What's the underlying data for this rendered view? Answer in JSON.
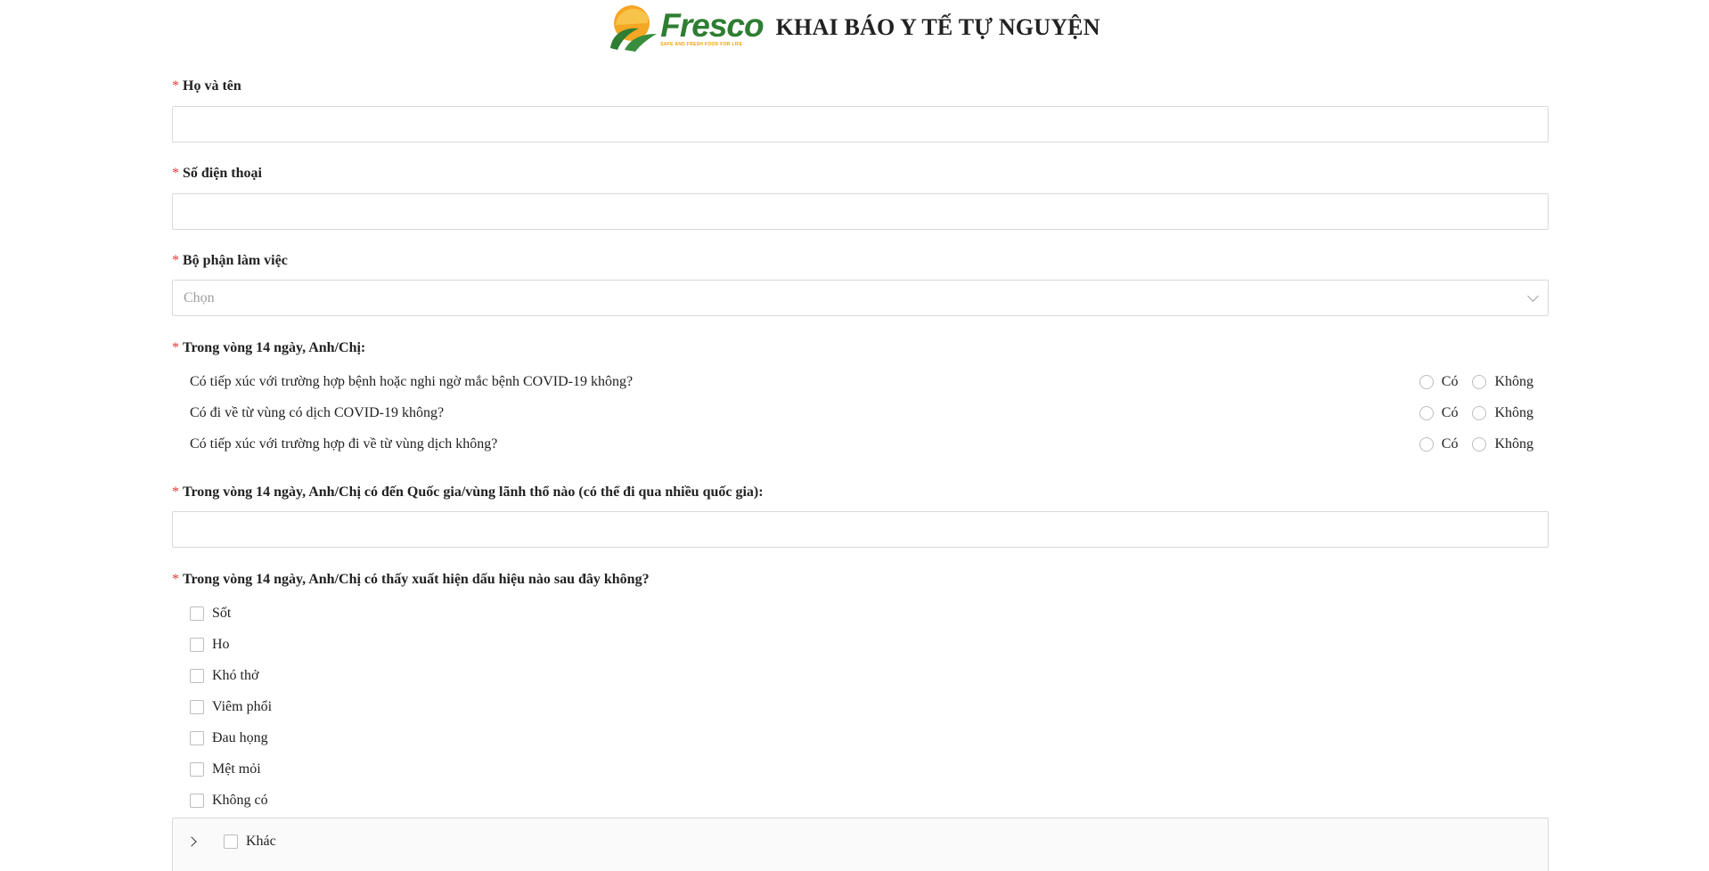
{
  "header": {
    "brand_name": "Fresco",
    "brand_tagline": "SAFE AND FRESH FOOD FOR LIFE",
    "title": "KHAI BÁO Y TẾ TỰ NGUYỆN",
    "colors": {
      "brand_green": "#2e7d32",
      "brand_orange": "#f0a000"
    }
  },
  "form": {
    "required_mark": "*",
    "full_name": {
      "label": "Họ và tên",
      "value": "",
      "placeholder": ""
    },
    "phone": {
      "label": "Số điện thoại",
      "value": "",
      "placeholder": ""
    },
    "department": {
      "label": "Bộ phận làm việc",
      "placeholder": "Chọn",
      "selected": ""
    },
    "exposure": {
      "label": "Trong vòng 14 ngày, Anh/Chị:",
      "option_yes": "Có",
      "option_no": "Không",
      "questions": [
        {
          "text": "Có tiếp xúc với trường hợp bệnh hoặc nghi ngờ mắc bệnh COVID-19 không?",
          "answer": null
        },
        {
          "text": "Có đi về từ vùng có dịch COVID-19 không?",
          "answer": null
        },
        {
          "text": "Có tiếp xúc với trường hợp đi về từ vùng dịch không?",
          "answer": null
        }
      ]
    },
    "countries": {
      "label": "Trong vòng 14 ngày, Anh/Chị có đến Quốc gia/vùng lãnh thổ nào (có thể đi qua nhiều quốc gia):",
      "value": ""
    },
    "symptoms": {
      "label": "Trong vòng 14 ngày, Anh/Chị có thấy xuất hiện dấu hiệu nào sau đây không?",
      "items": [
        {
          "label": "Sốt",
          "checked": false
        },
        {
          "label": "Ho",
          "checked": false
        },
        {
          "label": "Khó thở",
          "checked": false
        },
        {
          "label": "Viêm phổi",
          "checked": false
        },
        {
          "label": "Đau họng",
          "checked": false
        },
        {
          "label": "Mệt mỏi",
          "checked": false
        },
        {
          "label": "Không có",
          "checked": false
        }
      ],
      "other": {
        "label": "Khác",
        "checked": false,
        "expanded": false
      }
    }
  }
}
